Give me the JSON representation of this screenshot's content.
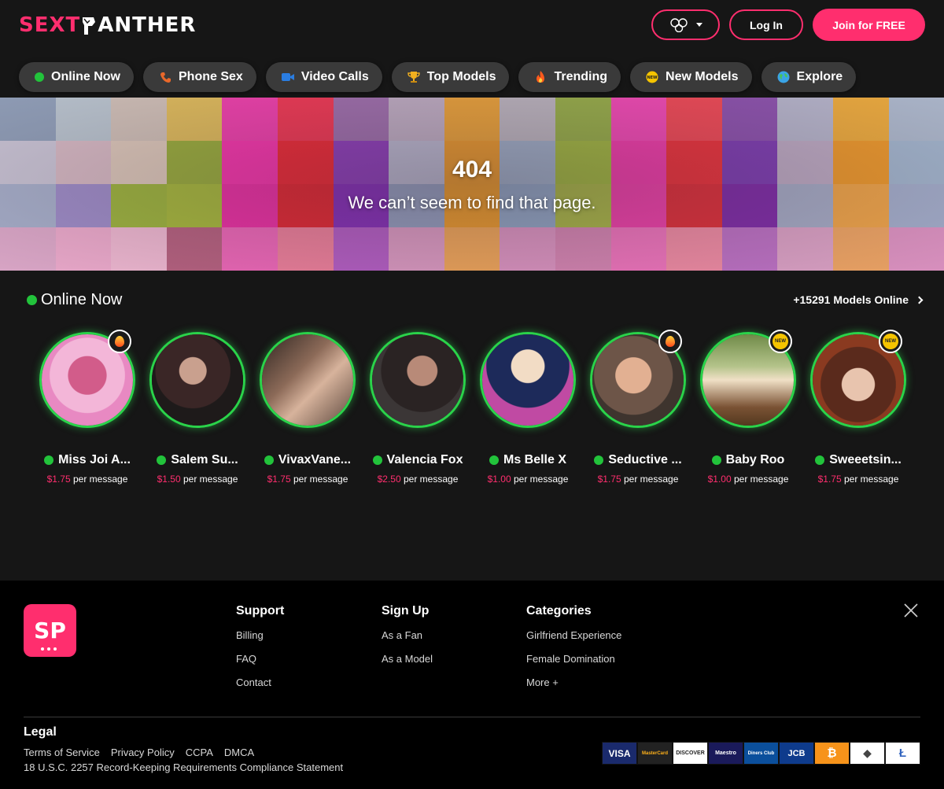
{
  "header": {
    "logo_part1": "SEXT",
    "logo_part2": "ANTHER",
    "login_label": "Log In",
    "join_label": "Join for FREE"
  },
  "nav": [
    {
      "label": "Online Now",
      "icon": "green-dot-icon"
    },
    {
      "label": "Phone Sex",
      "icon": "phone-icon"
    },
    {
      "label": "Video Calls",
      "icon": "video-camera-icon"
    },
    {
      "label": "Top Models",
      "icon": "trophy-icon"
    },
    {
      "label": "Trending",
      "icon": "fire-icon"
    },
    {
      "label": "New Models",
      "icon": "new-badge-icon"
    },
    {
      "label": "Explore",
      "icon": "globe-icon"
    }
  ],
  "banner": {
    "title": "404",
    "subtitle": "We can’t seem to find that page."
  },
  "online": {
    "title": "Online Now",
    "count_label": "+15291 Models Online",
    "per_label": "per message",
    "models": [
      {
        "name": "Miss Joi A...",
        "price": "$1.75",
        "badge": "fire"
      },
      {
        "name": "Salem Su...",
        "price": "$1.50",
        "badge": ""
      },
      {
        "name": "VivaxVane...",
        "price": "$1.75",
        "badge": ""
      },
      {
        "name": "Valencia Fox",
        "price": "$2.50",
        "badge": ""
      },
      {
        "name": "Ms Belle X",
        "price": "$1.00",
        "badge": ""
      },
      {
        "name": "Seductive ...",
        "price": "$1.75",
        "badge": "fire"
      },
      {
        "name": "Baby Roo",
        "price": "$1.00",
        "badge": "new"
      },
      {
        "name": "Sweeetsin...",
        "price": "$1.75",
        "badge": "new"
      }
    ]
  },
  "footer": {
    "logo_text": "SP",
    "support": {
      "title": "Support",
      "links": [
        "Billing",
        "FAQ",
        "Contact"
      ]
    },
    "signup": {
      "title": "Sign Up",
      "links": [
        "As a Fan",
        "As a Model"
      ]
    },
    "categories": {
      "title": "Categories",
      "links": [
        "Girlfriend Experience",
        "Female Domination",
        "More +"
      ]
    },
    "legal": {
      "title": "Legal",
      "links": [
        "Terms of Service",
        "Privacy Policy",
        "CCPA",
        "DMCA"
      ],
      "statement": "18 U.S.C. 2257 Record-Keeping Requirements Compliance Statement"
    },
    "payment_methods": [
      {
        "label": "VISA",
        "color": "#1a2a6c"
      },
      {
        "label": "MasterCard",
        "color": "#222222"
      },
      {
        "label": "DISCOVER",
        "color": "#ffffff"
      },
      {
        "label": "Maestro",
        "color": "#1a1a5a"
      },
      {
        "label": "Diners Club",
        "color": "#0b4f9c"
      },
      {
        "label": "JCB",
        "color": "#0e3b8c"
      },
      {
        "label": "₿",
        "color": "#f7931a"
      },
      {
        "label": "◆",
        "color": "#ffffff"
      },
      {
        "label": "Ł",
        "color": "#ffffff"
      }
    ]
  },
  "colors": {
    "accent": "#ff2e6e",
    "online": "#2ad34a"
  }
}
